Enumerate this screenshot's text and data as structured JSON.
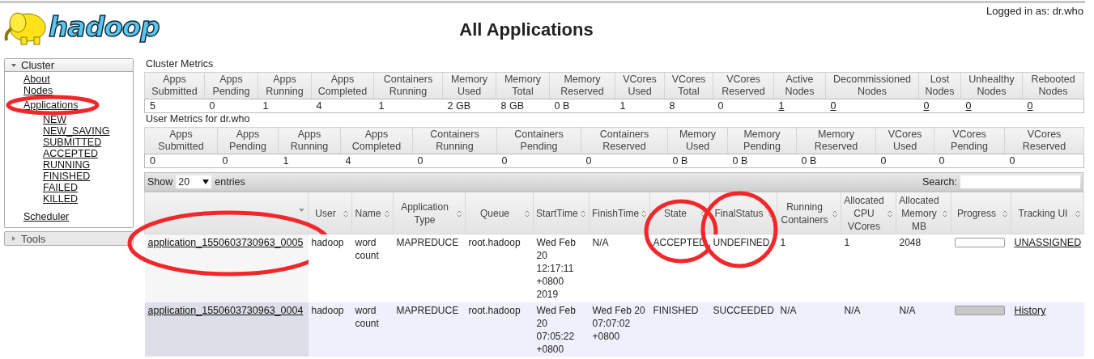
{
  "header": {
    "logo_text": "hadoop",
    "title": "All Applications",
    "login": "Logged in as: dr.who"
  },
  "sidebar": {
    "sections": [
      {
        "title": "Cluster",
        "expanded": true,
        "items": [
          {
            "label": "About",
            "circled": false
          },
          {
            "label": "Nodes",
            "circled": false
          },
          {
            "label": "Applications",
            "circled": true,
            "children": [
              {
                "label": "NEW"
              },
              {
                "label": "NEW_SAVING"
              },
              {
                "label": "SUBMITTED"
              },
              {
                "label": "ACCEPTED"
              },
              {
                "label": "RUNNING"
              },
              {
                "label": "FINISHED"
              },
              {
                "label": "FAILED"
              },
              {
                "label": "KILLED"
              }
            ]
          },
          {
            "label": "Scheduler",
            "circled": false
          }
        ]
      },
      {
        "title": "Tools",
        "expanded": false
      }
    ]
  },
  "cluster_metrics": {
    "title": "Cluster Metrics",
    "columns": [
      {
        "label": "Apps Submitted",
        "value": "5",
        "link": false
      },
      {
        "label": "Apps Pending",
        "value": "0",
        "link": false
      },
      {
        "label": "Apps Running",
        "value": "1",
        "link": false
      },
      {
        "label": "Apps Completed",
        "value": "4",
        "link": false
      },
      {
        "label": "Containers Running",
        "value": "1",
        "link": false
      },
      {
        "label": "Memory Used",
        "value": "2 GB",
        "link": false
      },
      {
        "label": "Memory Total",
        "value": "8 GB",
        "link": false
      },
      {
        "label": "Memory Reserved",
        "value": "0 B",
        "link": false
      },
      {
        "label": "VCores Used",
        "value": "1",
        "link": false
      },
      {
        "label": "VCores Total",
        "value": "8",
        "link": false
      },
      {
        "label": "VCores Reserved",
        "value": "0",
        "link": false
      },
      {
        "label": "Active Nodes",
        "value": "1",
        "link": true
      },
      {
        "label": "Decommissioned Nodes",
        "value": "0",
        "link": true
      },
      {
        "label": "Lost Nodes",
        "value": "0",
        "link": true
      },
      {
        "label": "Unhealthy Nodes",
        "value": "0",
        "link": true
      },
      {
        "label": "Rebooted Nodes",
        "value": "0",
        "link": true
      }
    ]
  },
  "user_metrics": {
    "title": "User Metrics for dr.who",
    "columns": [
      {
        "label": "Apps Submitted",
        "value": "0",
        "link": false
      },
      {
        "label": "Apps Pending",
        "value": "0",
        "link": false
      },
      {
        "label": "Apps Running",
        "value": "1",
        "link": false
      },
      {
        "label": "Apps Completed",
        "value": "4",
        "link": false
      },
      {
        "label": "Containers Running",
        "value": "0",
        "link": false
      },
      {
        "label": "Containers Pending",
        "value": "0",
        "link": false
      },
      {
        "label": "Containers Reserved",
        "value": "0",
        "link": false
      },
      {
        "label": "Memory Used",
        "value": "0 B",
        "link": false
      },
      {
        "label": "Memory Pending",
        "value": "0 B",
        "link": false
      },
      {
        "label": "Memory Reserved",
        "value": "0 B",
        "link": false
      },
      {
        "label": "VCores Used",
        "value": "0",
        "link": false
      },
      {
        "label": "VCores Pending",
        "value": "0",
        "link": false
      },
      {
        "label": "VCores Reserved",
        "value": "0",
        "link": false
      }
    ]
  },
  "apps_table": {
    "show_label": "Show",
    "page_size": "20",
    "entries_label": "entries",
    "search_label": "Search:",
    "columns": [
      {
        "sorted": true
      },
      {
        "label": "User",
        "sorted": false
      },
      {
        "label": "Name",
        "sorted": false
      },
      {
        "label": "Application Type",
        "sorted": false
      },
      {
        "label": "Queue",
        "sorted": false
      },
      {
        "label": "StartTime",
        "sorted": false
      },
      {
        "label": "FinishTime",
        "sorted": false
      },
      {
        "label": "State",
        "sorted": false
      },
      {
        "label": "FinalStatus",
        "sorted": false
      },
      {
        "label": "Running Containers",
        "sorted": false
      },
      {
        "label": "Allocated CPU VCores",
        "sorted": false
      },
      {
        "label": "Allocated Memory MB",
        "sorted": false
      },
      {
        "label": "Progress",
        "sorted": false
      },
      {
        "label": "Tracking UI",
        "sorted": false
      }
    ],
    "rows": [
      {
        "cells": [
          {
            "kind": "link",
            "text": "application_1550603730963_0005",
            "circled": true
          },
          {
            "kind": "text",
            "text": "hadoop",
            "circled": false
          },
          {
            "kind": "text",
            "text": "word count",
            "circled": false
          },
          {
            "kind": "text",
            "text": "MAPREDUCE",
            "circled": false
          },
          {
            "kind": "text",
            "text": "root.hadoop",
            "circled": false
          },
          {
            "kind": "text",
            "text": "Wed Feb 20 12:17:11 +0800 2019",
            "circled": false
          },
          {
            "kind": "text",
            "text": "N/A",
            "circled": false
          },
          {
            "kind": "text",
            "text": "ACCEPTED",
            "circled": true
          },
          {
            "kind": "text",
            "text": "UNDEFINED",
            "circled": true
          },
          {
            "kind": "text",
            "text": "1",
            "circled": false
          },
          {
            "kind": "text",
            "text": "1",
            "circled": false
          },
          {
            "kind": "text",
            "text": "2048",
            "circled": false
          },
          {
            "kind": "progress",
            "level": 0,
            "circled": false
          },
          {
            "kind": "link",
            "text": "UNASSIGNED",
            "circled": false
          }
        ]
      },
      {
        "cells": [
          {
            "kind": "link",
            "text": "application_1550603730963_0004",
            "circled": false
          },
          {
            "kind": "text",
            "text": "hadoop",
            "circled": false
          },
          {
            "kind": "text",
            "text": "word count",
            "circled": false
          },
          {
            "kind": "text",
            "text": "MAPREDUCE",
            "circled": false
          },
          {
            "kind": "text",
            "text": "root.hadoop",
            "circled": false
          },
          {
            "kind": "text",
            "text": "Wed Feb 20 07:05:22 +0800",
            "circled": false
          },
          {
            "kind": "text",
            "text": "Wed Feb 20 07:07:02 +0800",
            "circled": false
          },
          {
            "kind": "text",
            "text": "FINISHED",
            "circled": false
          },
          {
            "kind": "text",
            "text": "SUCCEEDED",
            "circled": false
          },
          {
            "kind": "text",
            "text": "N/A",
            "circled": false
          },
          {
            "kind": "text",
            "text": "N/A",
            "circled": false
          },
          {
            "kind": "text",
            "text": "N/A",
            "circled": false
          },
          {
            "kind": "progress",
            "level": 1,
            "circled": false
          },
          {
            "kind": "link",
            "text": "History",
            "circled": false
          }
        ]
      }
    ]
  }
}
